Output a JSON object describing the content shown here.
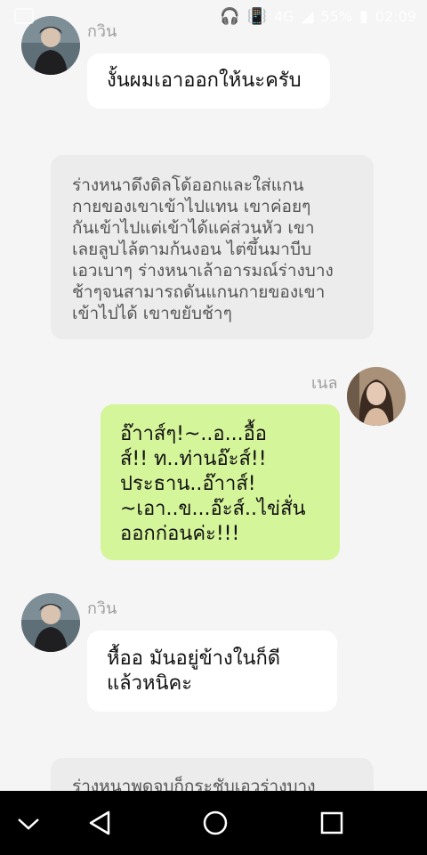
{
  "status_bar": {
    "battery": "55%",
    "time": "02:09",
    "network": "4G",
    "icons": [
      "headset-icon",
      "vibrate-icon",
      "signal-icon",
      "battery-icon"
    ]
  },
  "messages": [
    {
      "kind": "incoming",
      "sender": "กวิน",
      "lines": [
        "งั้นผมเอาออกให้นะครับ"
      ]
    },
    {
      "kind": "narration",
      "lines": [
        "ร่างหนาดึงดิลโด้ออกและใส่แกน",
        "กายของเขาเข้าไปแทน เขาค่อยๆ",
        "กันเข้าไปแต่เข้าได้แค่ส่วนหัว เขา",
        "เลยลูบไล้ตามก้นงอน ไต่ขึ้นมาบีบ",
        "เอวเบาๆ ร่างหนาเล้าอารมณ์ร่างบาง",
        "ช้าๆจนสามารถดันแกนกายของเขา",
        "เข้าไปได้ เขาขยับช้าๆ"
      ]
    },
    {
      "kind": "outgoing",
      "sender": "เนล",
      "lines": [
        "อ๊าาส์ๆ!~..อ...อื้อ",
        "ส์!! ท..ท่านอ๊ะส์!!",
        "ประธาน..อ๊าาส์!",
        "~เอา..ข...อ๊ะส์..ไข่สั่น",
        "ออกก่อนค่ะ!!!"
      ]
    },
    {
      "kind": "incoming",
      "sender": "กวิน",
      "lines": [
        "หื้ออ มันอยู่ข้างในก็ดี",
        "แล้วหนิคะ"
      ]
    },
    {
      "kind": "narration",
      "lines": [
        "ร่างหนาพูดจบก็กระชับเอวร่างบาง"
      ]
    }
  ],
  "nav": {
    "buttons": [
      "chevron-down-icon",
      "back-icon",
      "home-icon",
      "recents-icon"
    ]
  }
}
